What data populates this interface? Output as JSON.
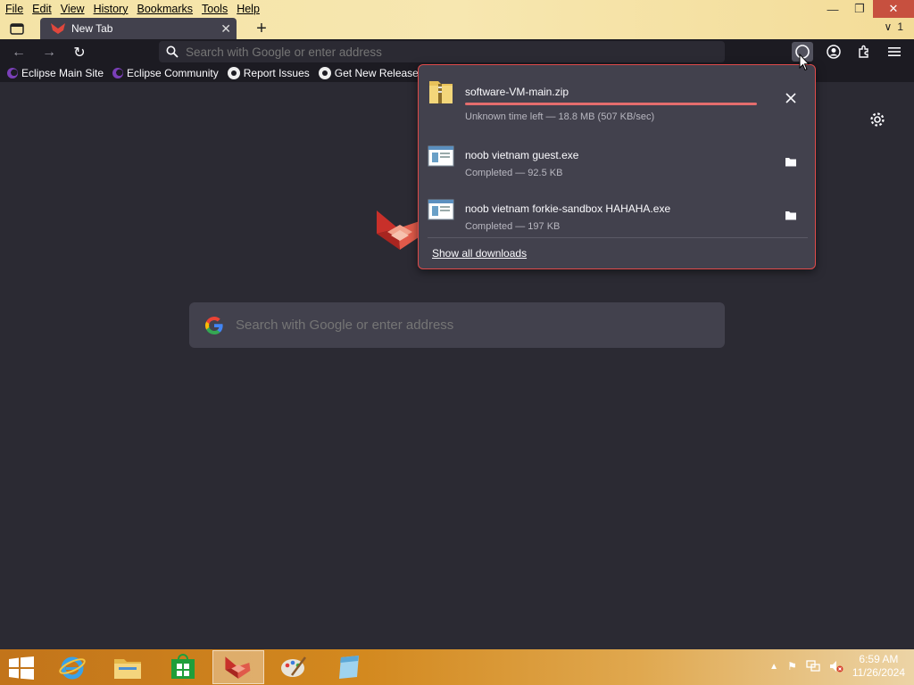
{
  "menu": {
    "items": [
      "File",
      "Edit",
      "View",
      "History",
      "Bookmarks",
      "Tools",
      "Help"
    ]
  },
  "window_controls": {
    "minimize": "—",
    "restore": "❐",
    "close": "✕"
  },
  "tabs": {
    "active_tab_title": "New Tab",
    "new_tab": "+",
    "tab_count_label": "1"
  },
  "navbar": {
    "url_placeholder": "Search with Google or enter address"
  },
  "bookmarks": [
    {
      "label": "Eclipse Main Site",
      "icon": "eclipse-icon"
    },
    {
      "label": "Eclipse Community",
      "icon": "eclipse-icon"
    },
    {
      "label": "Report Issues",
      "icon": "github-icon"
    },
    {
      "label": "Get New Releases",
      "icon": "github-icon"
    }
  ],
  "newtab": {
    "search_placeholder": "Search with Google or enter address"
  },
  "downloads": {
    "items": [
      {
        "name": "software-VM-main.zip",
        "status": "Unknown time left — 18.8 MB (507 KB/sec)",
        "progress": 1.0,
        "icon": "zip-folder-icon",
        "action": "cancel"
      },
      {
        "name": "noob vietnam guest.exe",
        "status": "Completed — 92.5 KB",
        "icon": "exe-icon",
        "action": "show-folder"
      },
      {
        "name": "noob vietnam forkie-sandbox HAHAHA.exe",
        "status": "Completed — 197 KB",
        "icon": "exe-icon",
        "action": "show-folder"
      }
    ],
    "show_all": "Show all downloads"
  },
  "taskbar": {
    "apps": [
      "internet-explorer-icon",
      "file-explorer-icon",
      "store-icon",
      "browser-icon",
      "paint-icon",
      "notepad-icon"
    ],
    "clock_time": "6:59 AM",
    "clock_date": "11/26/2024"
  },
  "colors": {
    "accent_red": "#e04a4a",
    "progress": "#e46d6d",
    "content_bg": "#2b2a33"
  }
}
